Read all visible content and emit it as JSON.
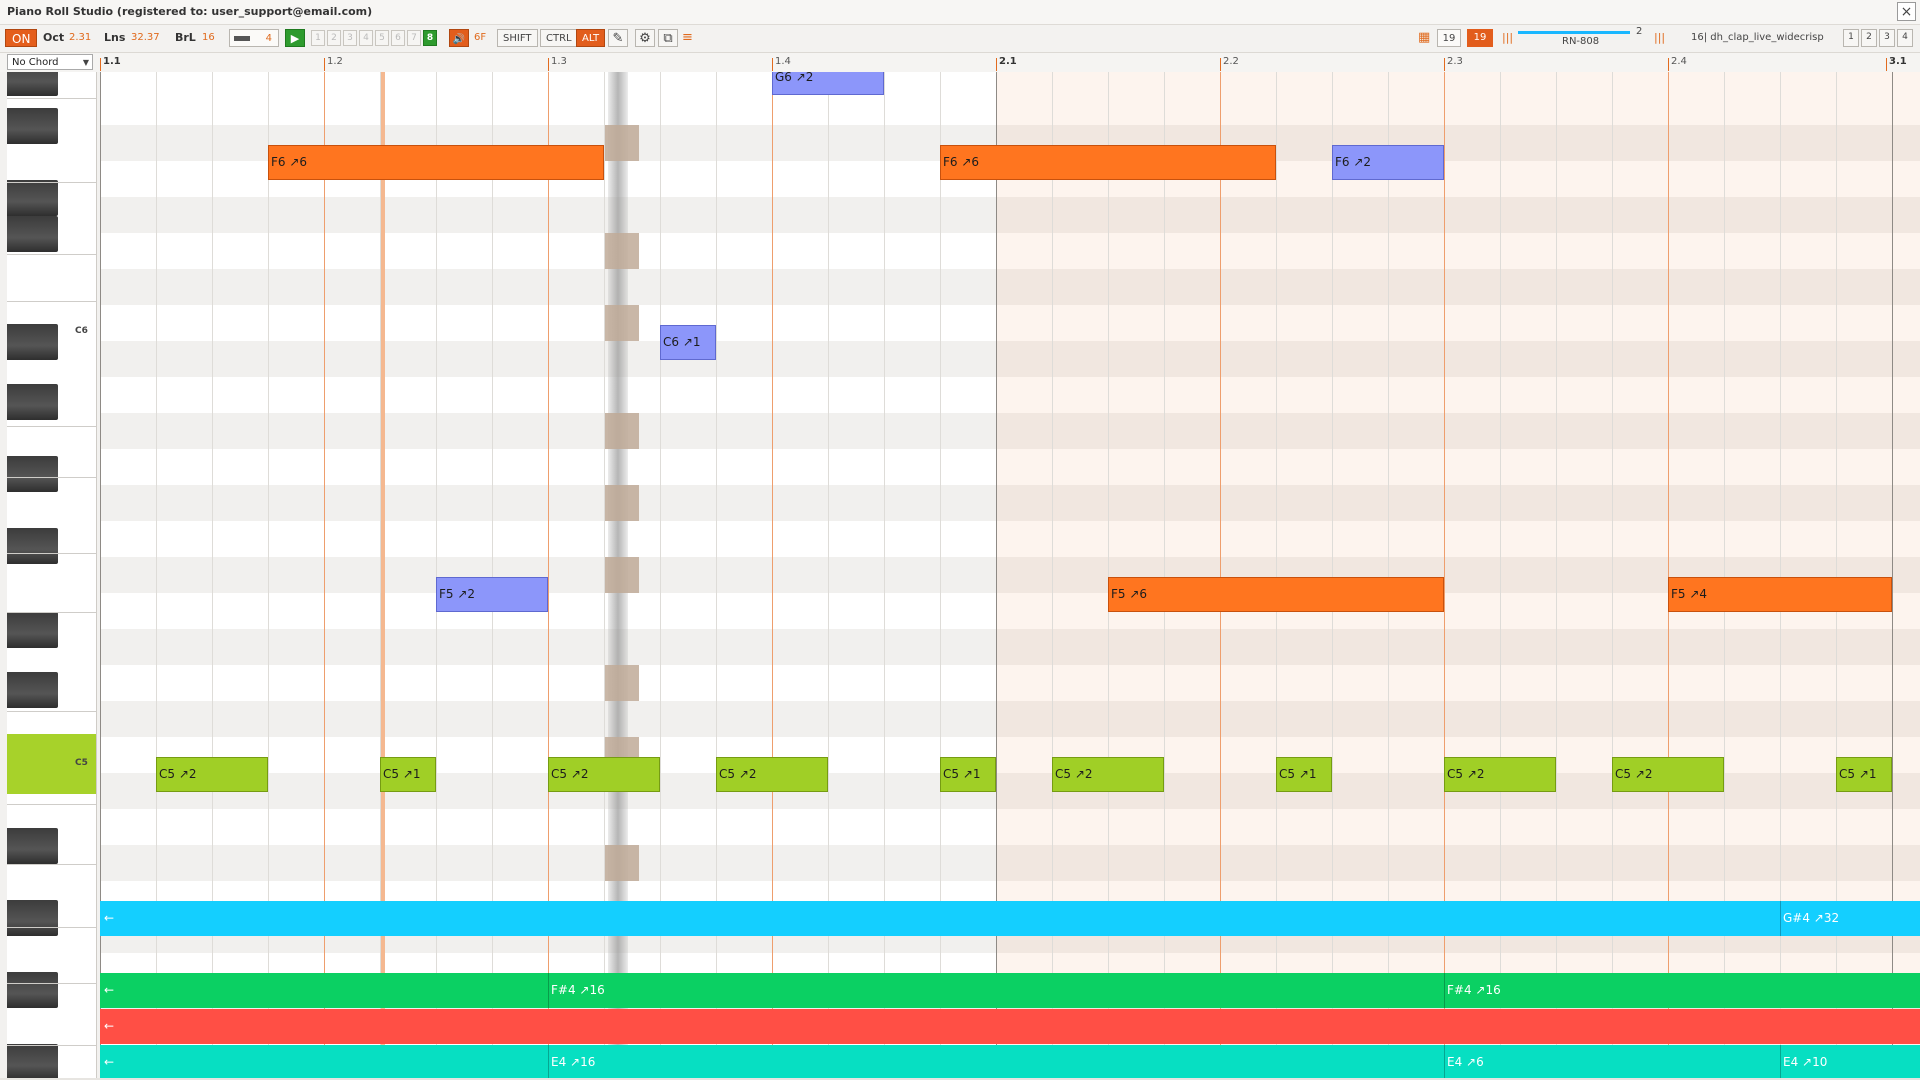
{
  "title": "Piano Roll Studio  (registered to: user_support@email.com)",
  "window": {
    "close_icon": "×"
  },
  "toolbar": {
    "on_label": "ON",
    "oct_label": "Oct",
    "oct_value": "2.31",
    "lns_label": "Lns",
    "lns_value": "32.37",
    "brl_label": "BrL",
    "brl_value": "16",
    "len_value": "4",
    "play_icon": "▶",
    "steps": [
      "1",
      "2",
      "3",
      "4",
      "5",
      "6",
      "7",
      "8"
    ],
    "active_step": "8",
    "speaker_icon": "🔊",
    "speaker_value": "6F",
    "shift_label": "SHIFT",
    "ctrl_label": "CTRL",
    "alt_label": "ALT",
    "tool_icon": "✎",
    "gear_icon": "⚙",
    "window_icon": "⧉",
    "sort_icon": "≡",
    "grid_icon": "▦",
    "count_a": "19",
    "count_b": "19",
    "slider_value": "2",
    "instrument": "RN-808",
    "piano_icon": "|||",
    "channel_label": "16| dh_clap_live_widecrisp",
    "groups": [
      "1",
      "2",
      "3",
      "4"
    ]
  },
  "ruler": {
    "chord": "No Chord",
    "labels": [
      "1.1",
      "1.2",
      "1.3",
      "1.4",
      "2.1",
      "2.2",
      "2.3",
      "2.4",
      "3.1"
    ]
  },
  "piano": {
    "labels": {
      "c6": "C6",
      "c5": "C5"
    }
  },
  "notes": [
    {
      "label": "G6 ↗2",
      "color": "blue"
    },
    {
      "label": "F6 ↗6",
      "color": "orange"
    },
    {
      "label": "F6 ↗6",
      "color": "orange"
    },
    {
      "label": "F6 ↗2",
      "color": "blue"
    },
    {
      "label": "C6 ↗1",
      "color": "blue"
    },
    {
      "label": "F5 ↗2",
      "color": "blue"
    },
    {
      "label": "F5 ↗6",
      "color": "orange"
    },
    {
      "label": "F5 ↗4",
      "color": "orange"
    },
    {
      "label": "C5 ↗2",
      "color": "green"
    },
    {
      "label": "C5 ↗1",
      "color": "green"
    },
    {
      "label": "C5 ↗2",
      "color": "green"
    },
    {
      "label": "C5 ↗2",
      "color": "green"
    },
    {
      "label": "C5 ↗1",
      "color": "green"
    },
    {
      "label": "C5 ↗2",
      "color": "green"
    },
    {
      "label": "C5 ↗1",
      "color": "green"
    },
    {
      "label": "C5 ↗2",
      "color": "green"
    },
    {
      "label": "C5 ↗2",
      "color": "green"
    },
    {
      "label": "C5 ↗1",
      "color": "green"
    }
  ],
  "lanes": [
    {
      "color": "#14cfff",
      "arrow": "←",
      "notes": [
        "G#4 ↗32"
      ]
    },
    {
      "color": "#0bd063",
      "arrow": "←",
      "notes": [
        "F#4 ↗16",
        "F#4 ↗16"
      ]
    },
    {
      "color": "#ff4f45",
      "arrow": "←",
      "notes": []
    },
    {
      "color": "#07dfc2",
      "arrow": "←",
      "notes": [
        "E4 ↗16",
        "E4 ↗6",
        "E4 ↗10"
      ]
    }
  ],
  "colors": {
    "accent": "#e45e1c",
    "note_orange": "#ff751f",
    "note_blue": "#8c96fa",
    "note_green": "#a0cf26",
    "playhead": "#c0aa98"
  }
}
